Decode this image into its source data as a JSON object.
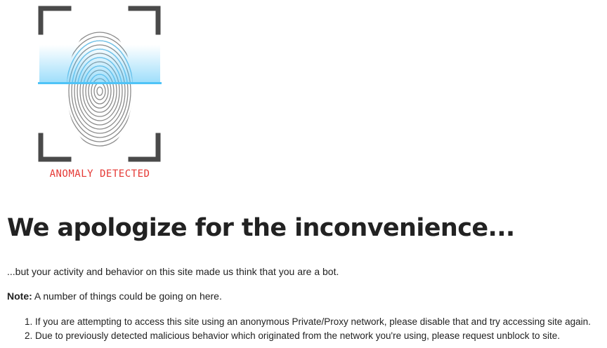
{
  "logo": {
    "icon": "fingerprint-scan-icon",
    "caption": "ANOMALY DETECTED",
    "caption_color": "#e53935",
    "scan_color": "#4fc3f7"
  },
  "heading": "We apologize for the inconvenience...",
  "intro": "...but your activity and behavior on this site made us think that you are a bot.",
  "note": {
    "label": "Note:",
    "text": " A number of things could be going on here."
  },
  "reasons": [
    "If you are attempting to access this site using an anonymous Private/Proxy network, please disable that and try accessing site again.",
    "Due to previously detected malicious behavior which originated from the network you're using, please request unblock to site."
  ]
}
